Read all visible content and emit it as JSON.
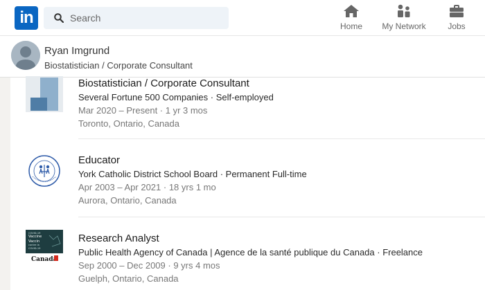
{
  "nav": {
    "search_placeholder": "Search",
    "items": [
      {
        "label": "Home",
        "icon": "home-icon"
      },
      {
        "label": "My Network",
        "icon": "network-icon"
      },
      {
        "label": "Jobs",
        "icon": "briefcase-icon"
      }
    ],
    "brand_color": "#0a66c2"
  },
  "profile": {
    "name": "Ryan Imgrund",
    "headline": "Biostatistician / Corporate Consultant"
  },
  "experience": [
    {
      "title": "Biostatistician / Corporate Consultant",
      "company": "Several Fortune 500 Companies · Self-employed",
      "dates": "Mar 2020 – Present · 1 yr 3 mos",
      "location": "Toronto, Ontario, Canada"
    },
    {
      "title": "Educator",
      "company": "York Catholic District School Board · Permanent Full-time",
      "dates": "Apr 2003 – Apr 2021 · 18 yrs 1 mo",
      "location": "Aurora, Ontario, Canada"
    },
    {
      "title": "Research Analyst",
      "company": "Public Health Agency of Canada | Agence de la santé publique du Canada · Freelance",
      "dates": "Sep 2000 – Dec 2009 · 9 yrs 4 mos",
      "location": "Guelph, Ontario, Canada",
      "logo_text": {
        "line1": "COVID-19",
        "line2": "Vaccine",
        "line3": "Vaccin",
        "line4": "contre la",
        "line5": "COVID-19",
        "wordmark": "Canada"
      }
    }
  ]
}
